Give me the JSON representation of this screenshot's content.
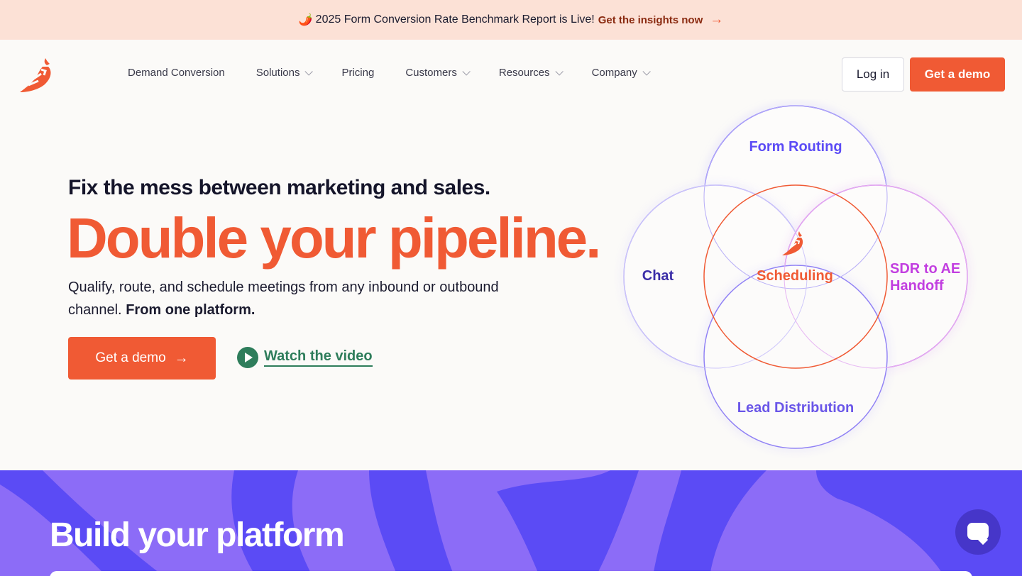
{
  "banner": {
    "emoji": "🌶️",
    "text": "2025 Form Conversion Rate Benchmark Report is Live!",
    "link": "Get the insights now",
    "arrow": "→"
  },
  "nav": {
    "items": [
      {
        "label": "Demand Conversion",
        "dropdown": false
      },
      {
        "label": "Solutions",
        "dropdown": true
      },
      {
        "label": "Pricing",
        "dropdown": false
      },
      {
        "label": "Customers",
        "dropdown": true
      },
      {
        "label": "Resources",
        "dropdown": true
      },
      {
        "label": "Company",
        "dropdown": true
      }
    ],
    "login": "Log in",
    "demo": "Get a demo"
  },
  "hero": {
    "eyebrow": "Fix the mess between marketing and sales.",
    "title": "Double your pipeline.",
    "description": "Qualify, route, and schedule meetings from any inbound or outbound channel.",
    "description_bold": "From one platform.",
    "cta": "Get a demo",
    "cta_arrow": "→",
    "video": "Watch the video"
  },
  "venn": {
    "top": "Form Routing",
    "left": "Chat",
    "center": "Scheduling",
    "right_line1": "SDR to AE",
    "right_line2": "Handoff",
    "bottom": "Lead Distribution"
  },
  "section2": {
    "title": "Build your platform"
  },
  "colors": {
    "brand": "#f05a34",
    "purple": "#5b4bf5",
    "magenta": "#c23fe0",
    "green": "#2e7d5b"
  }
}
